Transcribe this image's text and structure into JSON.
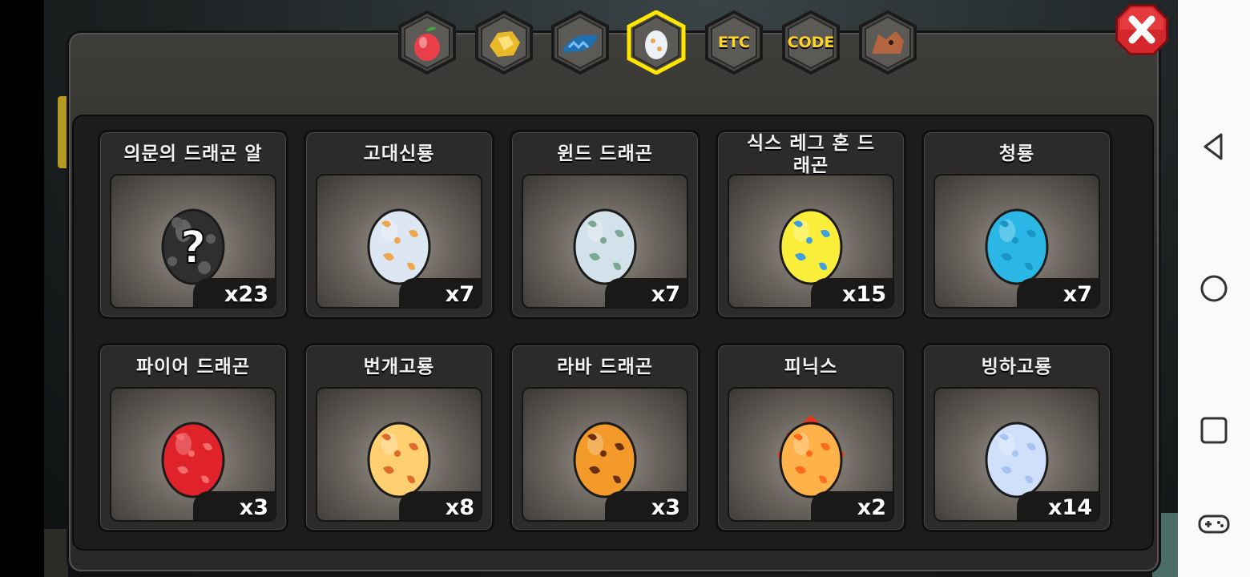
{
  "tabs": [
    {
      "id": "fruit",
      "icon": "fruit-icon",
      "active": false
    },
    {
      "id": "gold",
      "icon": "gold-ore-icon",
      "active": false
    },
    {
      "id": "scale",
      "icon": "dragon-scale-icon",
      "active": false
    },
    {
      "id": "egg",
      "icon": "egg-icon",
      "active": true
    },
    {
      "id": "etc",
      "label": "ETC",
      "active": false
    },
    {
      "id": "code",
      "label": "CODE",
      "active": false
    },
    {
      "id": "dragon",
      "icon": "dragon-head-icon",
      "active": false
    }
  ],
  "eggs": [
    {
      "name": "의문의 드래곤 알",
      "count": "x23",
      "color": "#2f2f2f",
      "spots": "#5c5c5c",
      "mystery": true
    },
    {
      "name": "고대신룡",
      "count": "x7",
      "color": "#dde7f4",
      "spots": "#f0a64e"
    },
    {
      "name": "윈드 드래곤",
      "count": "x7",
      "color": "#d3e1ea",
      "spots": "#7aa894"
    },
    {
      "name": "식스 레그 혼 드래곤",
      "count": "x15",
      "color": "#fbee3a",
      "spots": "#3f9fe0"
    },
    {
      "name": "청룡",
      "count": "x7",
      "color": "#2bb7e6",
      "spots": "#1a95c4"
    },
    {
      "name": "파이어 드래곤",
      "count": "x3",
      "color": "#e0222a",
      "spots": "#f36d6d"
    },
    {
      "name": "번개고룡",
      "count": "x8",
      "color": "#ffcf70",
      "spots": "#e06a2a"
    },
    {
      "name": "라바 드래곤",
      "count": "x3",
      "color": "#f39a2a",
      "spots": "#6b2f12"
    },
    {
      "name": "피닉스",
      "count": "x2",
      "color": "#ffb24a",
      "spots": "#ff6a1f",
      "fire": true
    },
    {
      "name": "빙하고룡",
      "count": "x14",
      "color": "#cfe0fb",
      "spots": "#a9c3f0"
    }
  ],
  "close_icon": "close-icon",
  "nav": [
    "back-icon",
    "home-icon",
    "recents-icon",
    "gamepad-icon"
  ]
}
